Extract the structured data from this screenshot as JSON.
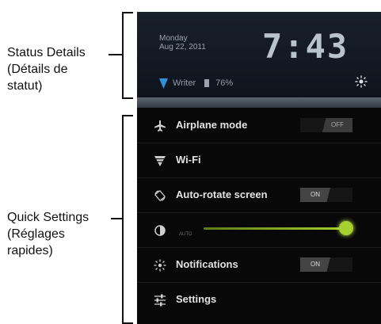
{
  "callouts": {
    "status": {
      "line1": "Status Details",
      "line2": "(Détails de",
      "line3": "statut)"
    },
    "quick": {
      "line1": "Quick Settings",
      "line2": "(Réglages",
      "line3": "rapides)"
    }
  },
  "status_bar": {
    "day": "Monday",
    "date": "Aug 22, 2011",
    "time": "7:43",
    "network": "Writer",
    "battery": "76%"
  },
  "quick_settings": {
    "airplane": {
      "label": "Airplane mode",
      "toggle": "OFF"
    },
    "wifi": {
      "label": "Wi-Fi"
    },
    "autorotate": {
      "label": "Auto-rotate screen",
      "toggle": "ON"
    },
    "brightness": {
      "auto_label": "AUTO",
      "level": 1.0
    },
    "notifications": {
      "label": "Notifications",
      "toggle": "ON"
    },
    "settings": {
      "label": "Settings"
    }
  },
  "colors": {
    "accent": "#a5d030"
  }
}
